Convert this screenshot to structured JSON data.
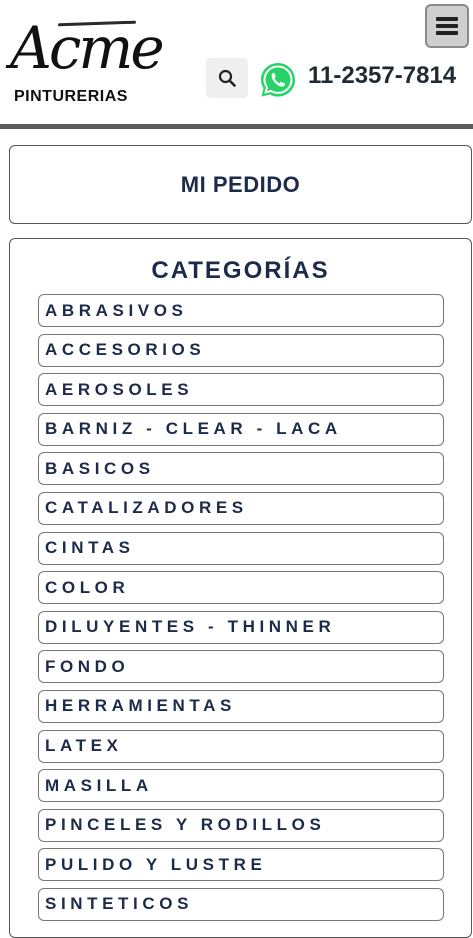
{
  "header": {
    "logo_text": "Acme",
    "logo_subtitle": "PINTURERIAS",
    "phone": "11-2357-7814",
    "icons": {
      "menu": "hamburger-menu-icon",
      "search": "search-icon",
      "whatsapp": "whatsapp-icon"
    }
  },
  "order": {
    "label": "MI PEDIDO"
  },
  "categories": {
    "title": "CATEGORÍAS",
    "items": [
      "ABRASIVOS",
      "ACCESORIOS",
      "AEROSOLES",
      "BARNIZ - CLEAR - LACA",
      "BASICOS",
      "CATALIZADORES",
      "CINTAS",
      "COLOR",
      "DILUYENTES - THINNER",
      "FONDO",
      "HERRAMIENTAS",
      "LATEX",
      "MASILLA",
      "PINCELES Y RODILLOS",
      "PULIDO Y LUSTRE",
      "SINTETICOS"
    ]
  },
  "colors": {
    "text_navy": "#1c2b4a",
    "header_rule": "#5b5b5b",
    "whatsapp_green": "#25d366"
  }
}
